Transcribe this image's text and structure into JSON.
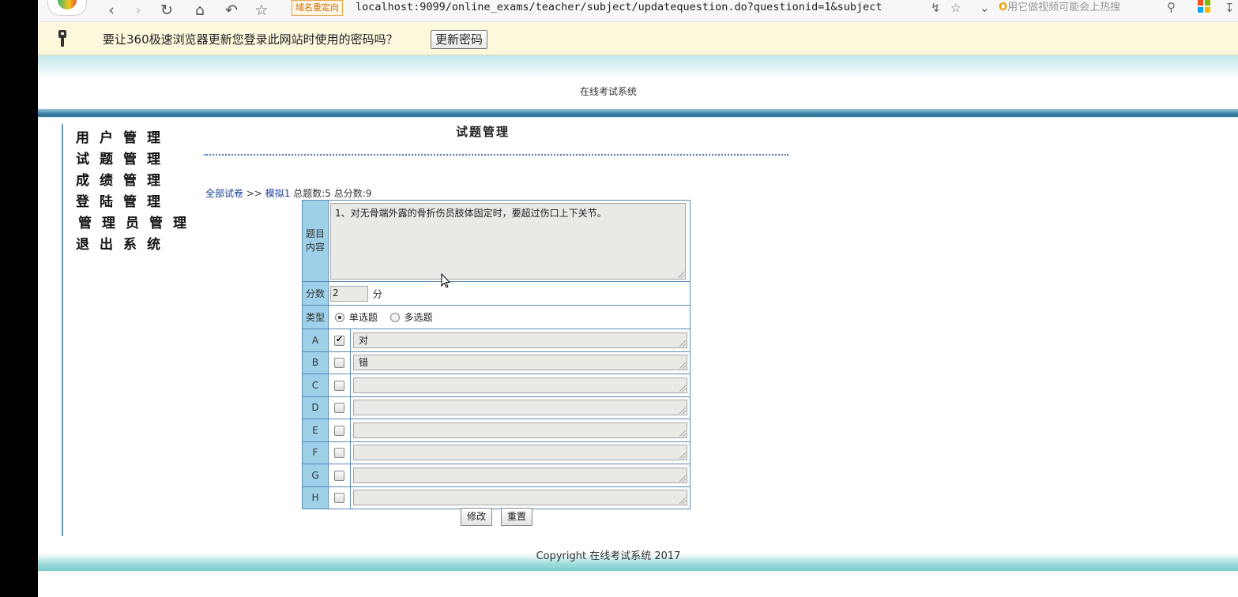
{
  "browser": {
    "redirect_badge": "域名重定向",
    "url": "localhost:9099/online_exams/teacher/subject/updatequestion.do?questionid=1&subject",
    "search_placeholder": "用它做视频可能会上热搜",
    "icons": [
      "back-icon",
      "forward-icon",
      "reload-icon",
      "home-icon",
      "undo-icon",
      "star-icon",
      "lightning-icon",
      "bookmark-icon",
      "dropdown-icon",
      "search-icon",
      "apps-icon",
      "download-icon"
    ]
  },
  "password_bar": {
    "message": "要让360极速浏览器更新您登录此网站时使用的密码吗？",
    "button": "更新密码"
  },
  "site": {
    "title": "在线考试系统",
    "copyright": "Copyright 在线考试系统 2017"
  },
  "sidebar": {
    "items": [
      {
        "label": "用户管理"
      },
      {
        "label": "试题管理"
      },
      {
        "label": "成绩管理"
      },
      {
        "label": "登陆管理"
      },
      {
        "label": "管理员管理"
      },
      {
        "label": "退出系统"
      }
    ]
  },
  "main": {
    "section_title": "试题管理",
    "breadcrumb": {
      "all_papers": "全部试卷",
      "separator": ">>",
      "paper": "模拟1",
      "total_questions": "总题数:5",
      "total_score": "总分数:9"
    },
    "form": {
      "content_label": "题目内容",
      "content_value": "1、对无骨端外露的骨折伤员肢体固定时，要超过伤口上下关节。",
      "score_label": "分数",
      "score_value": "2",
      "score_unit": "分",
      "type_label": "类型",
      "type_options": [
        {
          "label": "单选题",
          "selected": true
        },
        {
          "label": "多选题",
          "selected": false
        }
      ],
      "options": [
        {
          "letter": "A",
          "checked": true,
          "text": "对"
        },
        {
          "letter": "B",
          "checked": false,
          "text": "错"
        },
        {
          "letter": "C",
          "checked": false,
          "text": ""
        },
        {
          "letter": "D",
          "checked": false,
          "text": ""
        },
        {
          "letter": "E",
          "checked": false,
          "text": ""
        },
        {
          "letter": "F",
          "checked": false,
          "text": ""
        },
        {
          "letter": "G",
          "checked": false,
          "text": ""
        },
        {
          "letter": "H",
          "checked": false,
          "text": ""
        }
      ],
      "submit_label": "修改",
      "reset_label": "重置"
    }
  },
  "colors": {
    "header_line": "#2f6f96",
    "label_cell": "#9ed0e8",
    "table_border": "#5a8ab5",
    "link": "#1a3d96",
    "password_bar_bg": "#fdf8dc"
  }
}
